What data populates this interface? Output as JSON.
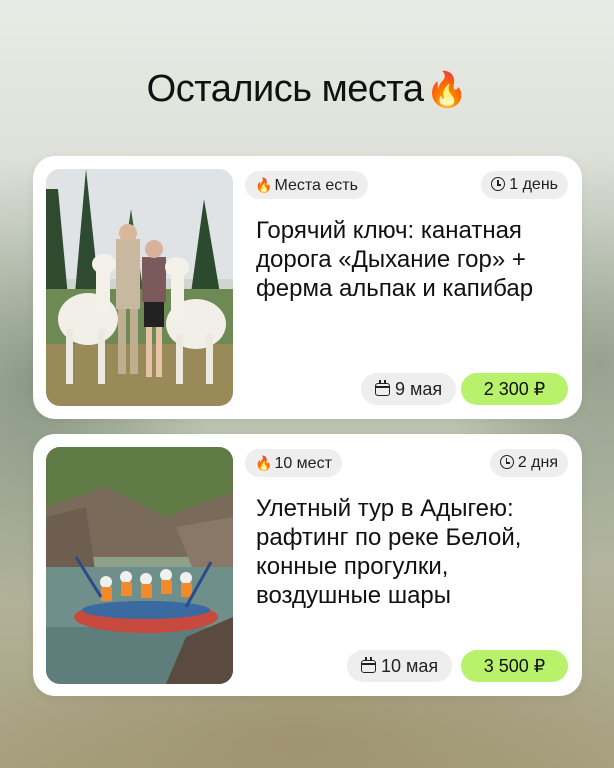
{
  "header": {
    "title": "Остались места",
    "title_emoji": "🔥"
  },
  "cards": [
    {
      "availability_icon": "🔥",
      "availability": "Места есть",
      "duration": "1 день",
      "title": "Горячий ключ: канатная дорога «Дыхание гор» + ферма альпак и капибар",
      "date": "9 мая",
      "price": "2 300 ₽"
    },
    {
      "availability_icon": "🔥",
      "availability": "10 мест",
      "duration": "2 дня",
      "title": "Улетный тур в Адыгею: рафтинг по реке Белой, конные прогулки, воздушные шары",
      "date": "10 мая",
      "price": "3 500 ₽"
    }
  ],
  "colors": {
    "price_bg": "#b7f26a",
    "chip_bg": "#eeeeee",
    "card_bg": "#ffffff"
  }
}
